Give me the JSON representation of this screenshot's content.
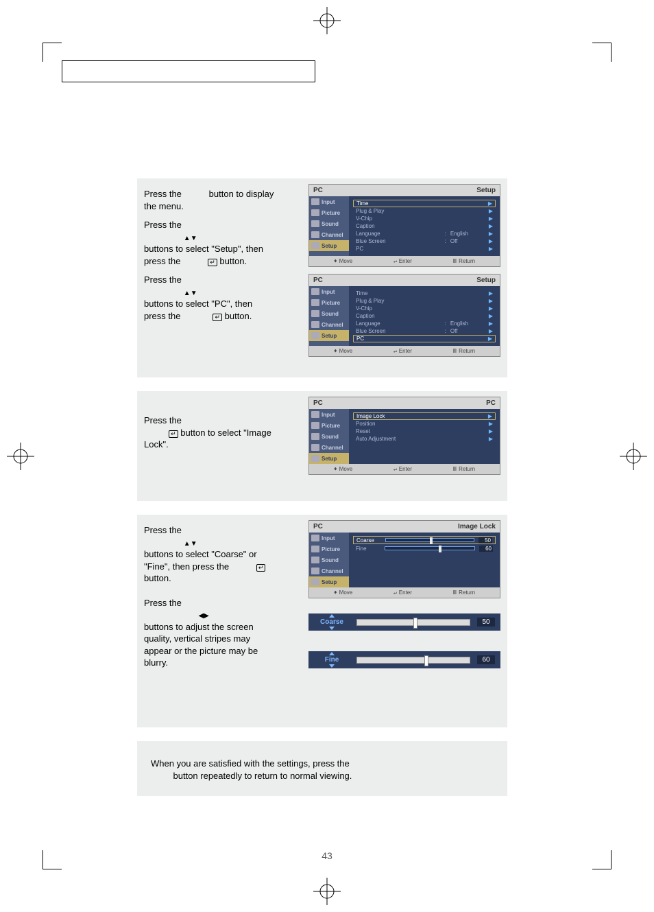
{
  "page_number": "43",
  "steps": {
    "s1a": "Press the",
    "s1a_after": "button to display the menu.",
    "s1b": "Press the",
    "s1b_arrows": "▲▼",
    "s1b_after": "buttons to select \"Setup\", then press the",
    "s1b_after2": "button.",
    "s1c": "Press the",
    "s1c_arrows": "▲▼",
    "s1c_after": "buttons to select \"PC\", then press the",
    "s1c_after2": "button.",
    "s2": "Press the",
    "s2_after": "button to select \"Image Lock\".",
    "s3a": "Press the",
    "s3a_arrows": "▲▼",
    "s3a_after": "buttons to select \"Coarse\" or \"Fine\", then press the",
    "s3a_after2": "button.",
    "s3b": "Press the",
    "s3b_arrows": "◀▶",
    "s3b_after": "buttons to adjust the screen quality, vertical stripes may appear or the picture may be blurry.",
    "s4": "When you are satisfied with the settings, press the",
    "s4_after": "button repeatedly to return to normal viewing."
  },
  "osd": {
    "breadcrumb_left": "PC",
    "setup_label": "Setup",
    "pc_label": "PC",
    "imagelock_label": "Image Lock",
    "side": {
      "input": "Input",
      "picture": "Picture",
      "sound": "Sound",
      "channel": "Channel",
      "setup": "Setup"
    },
    "rows": {
      "time": "Time",
      "plug": "Plug & Play",
      "vchip": "V-Chip",
      "caption": "Caption",
      "language": "Language",
      "language_val": "English",
      "bluescreen": "Blue Screen",
      "bluescreen_val": "Off",
      "pc": "PC",
      "imagelock": "Image Lock",
      "position": "Position",
      "reset": "Reset",
      "autoadj": "Auto Adjustment",
      "coarse": "Coarse",
      "coarse_val": "50",
      "fine": "Fine",
      "fine_val": "60"
    },
    "footer": {
      "move": "Move",
      "enter": "Enter",
      "return": "Return"
    },
    "colon": ":"
  },
  "sliders": {
    "coarse_name": "Coarse",
    "coarse_val": "50",
    "fine_name": "Fine",
    "fine_val": "60"
  }
}
